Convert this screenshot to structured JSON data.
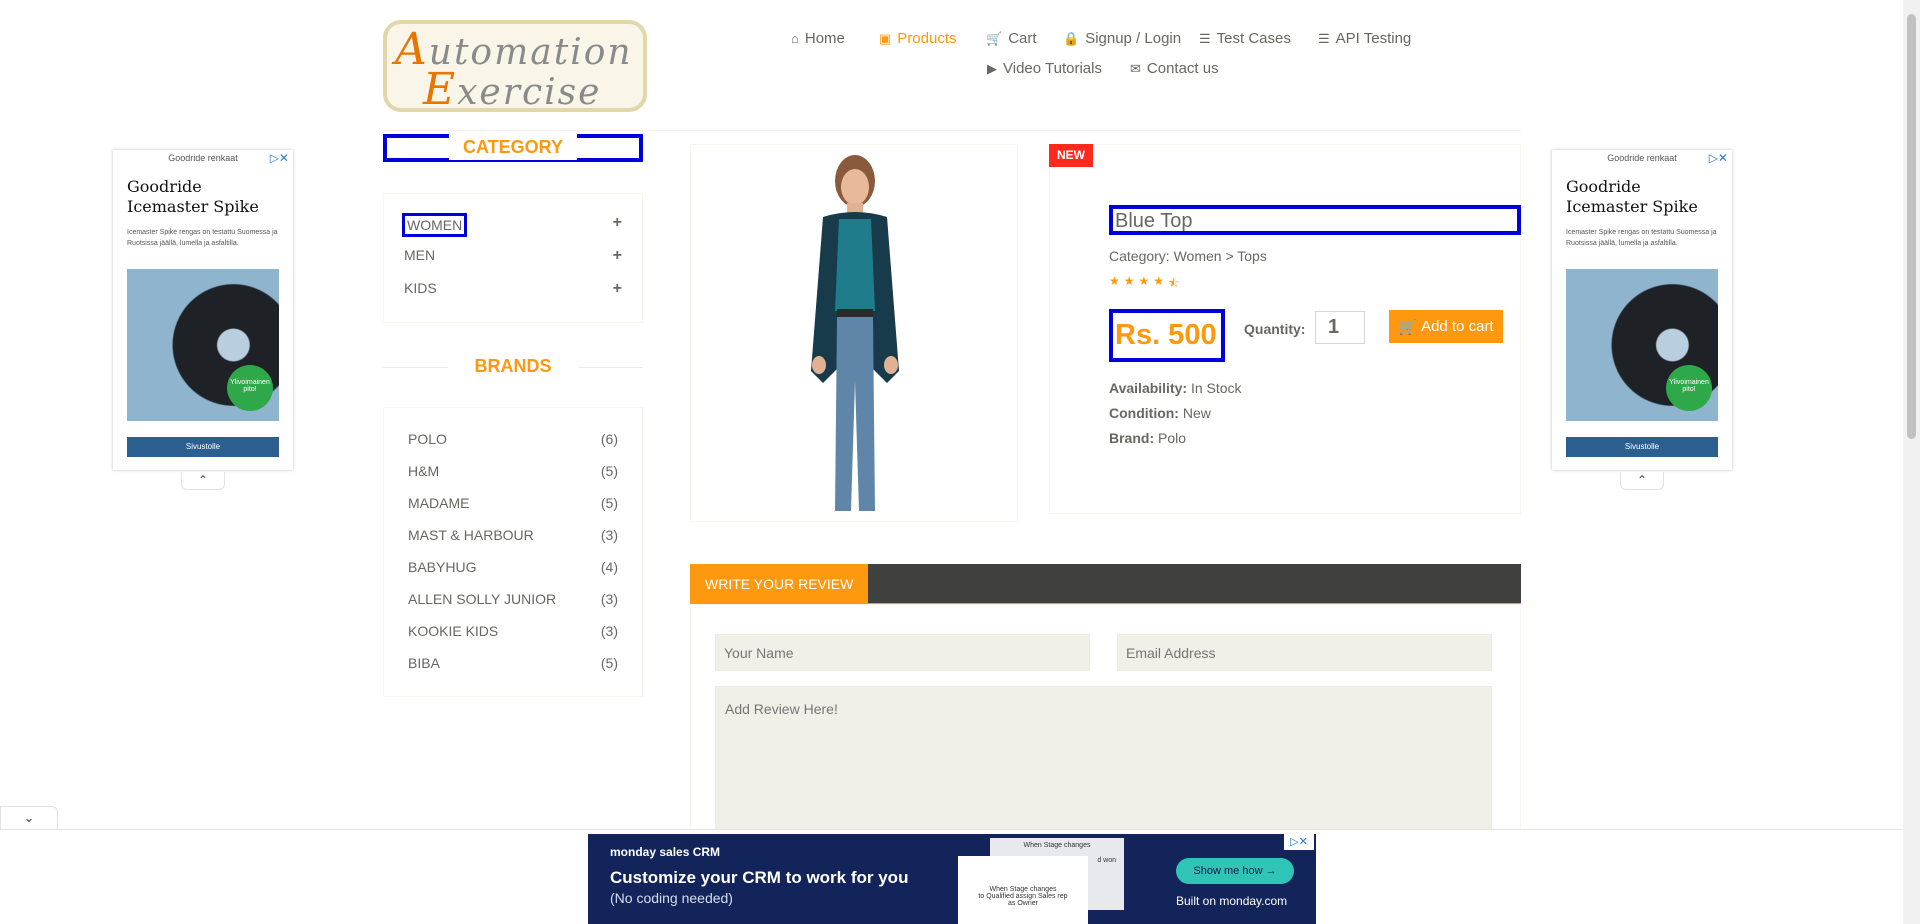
{
  "header": {
    "logo_line1_cap": "A",
    "logo_line1_rest": "utomation",
    "logo_line2_cap": "E",
    "logo_line2_rest": "xercise",
    "nav": {
      "home": "Home",
      "products": "Products",
      "cart": "Cart",
      "signup_login": "Signup / Login",
      "test_cases": "Test Cases",
      "api_testing": "API Testing",
      "video_tutorials": "Video Tutorials",
      "contact_us": "Contact us"
    }
  },
  "sidebar": {
    "category_title": "CATEGORY",
    "categories": [
      "WOMEN",
      "MEN",
      "KIDS"
    ],
    "category_expand_icon": "+",
    "brands_title": "BRANDS",
    "brands": [
      {
        "name": "POLO",
        "count": "(6)"
      },
      {
        "name": "H&M",
        "count": "(5)"
      },
      {
        "name": "MADAME",
        "count": "(5)"
      },
      {
        "name": "MAST & HARBOUR",
        "count": "(3)"
      },
      {
        "name": "BABYHUG",
        "count": "(4)"
      },
      {
        "name": "ALLEN SOLLY JUNIOR",
        "count": "(3)"
      },
      {
        "name": "KOOKIE KIDS",
        "count": "(3)"
      },
      {
        "name": "BIBA",
        "count": "(5)"
      }
    ]
  },
  "product": {
    "badge": "NEW",
    "name": "Blue Top",
    "category": "Category: Women > Tops",
    "rating_stars": 4.5,
    "price": "Rs. 500",
    "quantity_label": "Quantity:",
    "quantity_value": "1",
    "add_to_cart": "Add to cart",
    "availability_label": "Availability:",
    "availability_value": " In Stock",
    "condition_label": "Condition:",
    "condition_value": " New",
    "brand_label": "Brand:",
    "brand_value": " Polo"
  },
  "review": {
    "tab_label": "WRITE YOUR REVIEW",
    "name_placeholder": "Your Name",
    "email_placeholder": "Email Address",
    "review_placeholder": "Add Review Here!"
  },
  "side_ad": {
    "header": "Goodride renkaat",
    "headline_line1": "Goodride",
    "headline_line2": "Icemaster Spike",
    "body": "Icemaster Spike rengas on testattu Suomessa ja Ruotsissa jäällä, lumella ja asfaltilla.",
    "badge_line1": "Ylivoimainen",
    "badge_line2": "pito!",
    "cta": "Sivustolle"
  },
  "bottom_ad": {
    "brand": "monday sales CRM",
    "headline": "Customize your CRM to work for you",
    "subline": "(No coding needed)",
    "card1_line1": "When Stage changes",
    "card1_line2": "d won",
    "card2_line1": "When Stage changes",
    "card2_line2": "to Qualified assign Sales rep",
    "card2_line3": "as Owner",
    "cta": "Show me how →",
    "built_on": "Built on monday.com"
  },
  "colors": {
    "accent": "#fe980f",
    "highlight_box": "#0000dd",
    "new_badge": "#fe2b1c",
    "review_bar": "#40403e",
    "ad_background": "#12245a"
  }
}
